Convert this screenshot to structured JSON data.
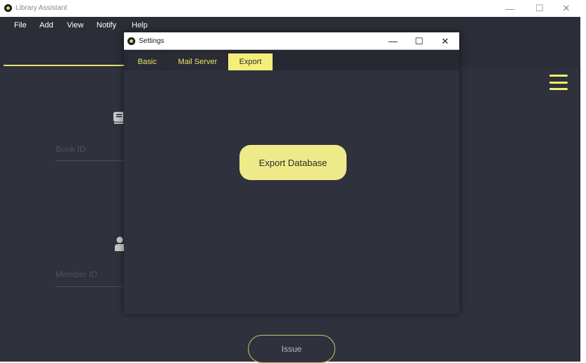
{
  "main_window": {
    "title": "Library Assistant",
    "controls": {
      "minimize": "—",
      "maximize": "☐",
      "close": "✕"
    }
  },
  "menubar": {
    "items": [
      {
        "label": "File"
      },
      {
        "label": "Add"
      },
      {
        "label": "View"
      },
      {
        "label": "Notify"
      },
      {
        "label": "Help"
      }
    ]
  },
  "form": {
    "book_id_placeholder": "Book ID",
    "member_id_placeholder": "Member ID",
    "issue_button": "Issue",
    "book_icon": "book-icon",
    "member_icon": "user-icon"
  },
  "hamburger_icon": "menu-icon",
  "settings_dialog": {
    "title": "Settings",
    "controls": {
      "minimize": "—",
      "maximize": "☐",
      "close": "✕"
    },
    "tabs": [
      {
        "label": "Basic",
        "active": false
      },
      {
        "label": "Mail Server",
        "active": false
      },
      {
        "label": "Export",
        "active": true
      }
    ],
    "export_button": "Export Database"
  },
  "colors": {
    "accent_yellow": "#f3ef7a",
    "background_dark": "#2f313c",
    "button_yellow": "#eeea8a"
  }
}
